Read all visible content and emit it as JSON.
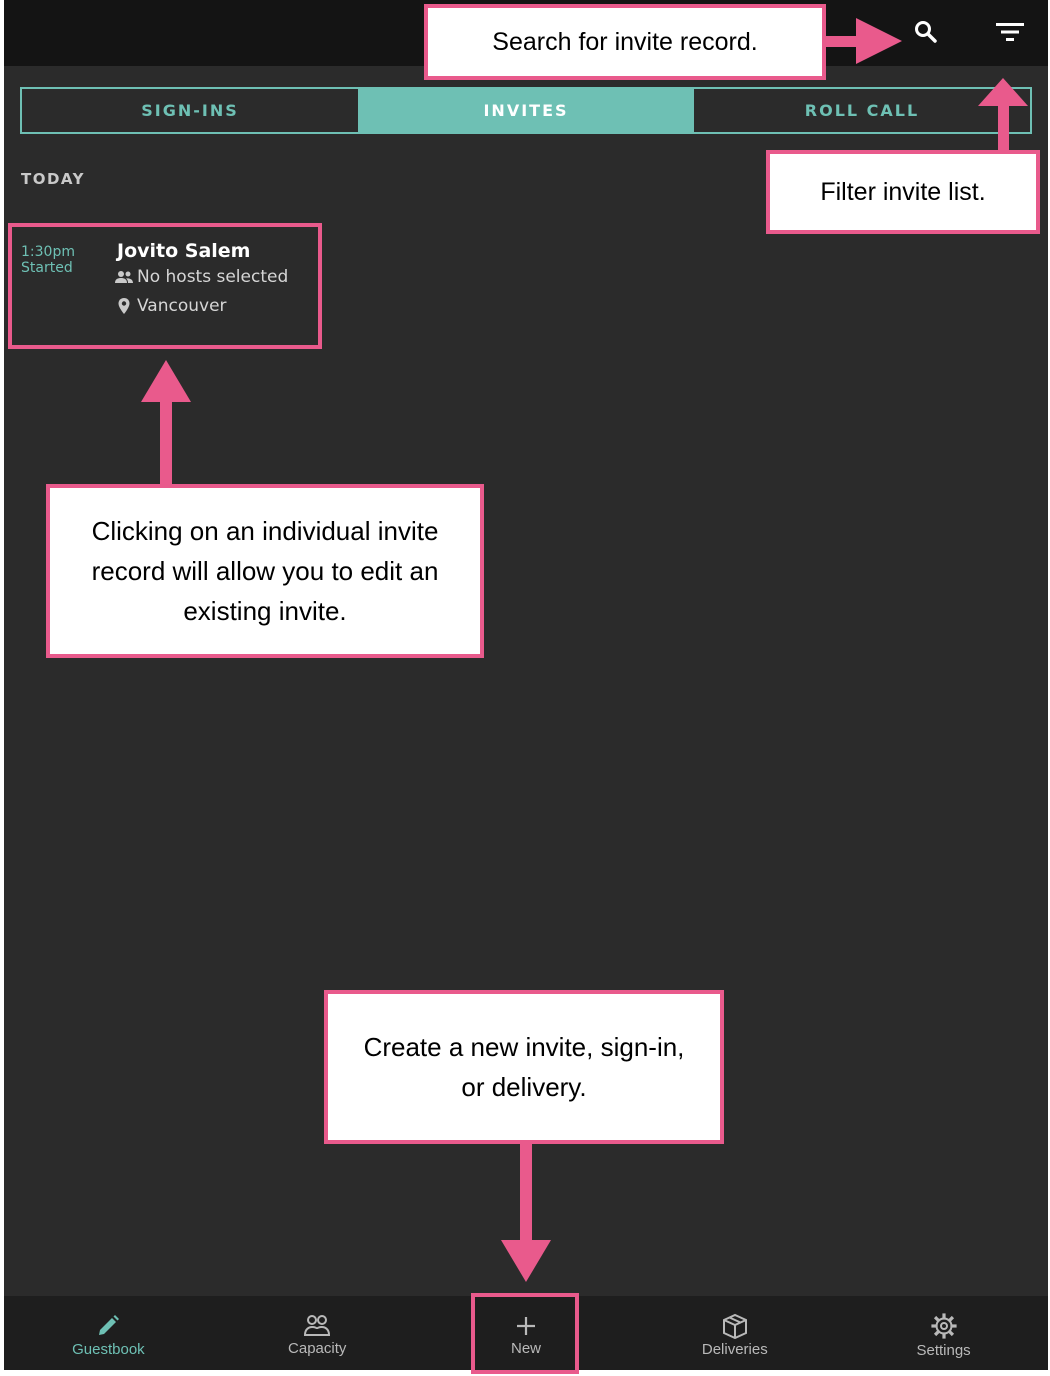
{
  "tabs": [
    {
      "label": "SIGN-INS",
      "active": false
    },
    {
      "label": "INVITES",
      "active": true
    },
    {
      "label": "ROLL CALL",
      "active": false
    }
  ],
  "section_label": "TODAY",
  "invite": {
    "time": "1:30pm",
    "status": "Started",
    "name": "Jovito Salem",
    "hosts": "No hosts selected",
    "location": "Vancouver"
  },
  "nav": [
    {
      "label": "Guestbook",
      "icon": "pencil-icon",
      "active": true
    },
    {
      "label": "Capacity",
      "icon": "people-icon",
      "active": false
    },
    {
      "label": "New",
      "icon": "plus-icon",
      "active": false
    },
    {
      "label": "Deliveries",
      "icon": "package-icon",
      "active": false
    },
    {
      "label": "Settings",
      "icon": "gear-icon",
      "active": false
    }
  ],
  "annotations": {
    "search": "Search for invite record.",
    "filter": "Filter invite list.",
    "edit": "Clicking on an individual invite record will allow you to edit an existing invite.",
    "create": "Create a new invite, sign-in, or delivery."
  },
  "colors": {
    "accent": "#6ec0b4",
    "annotation": "#e95a8c",
    "background": "#2b2b2b",
    "topbar": "#141414"
  }
}
